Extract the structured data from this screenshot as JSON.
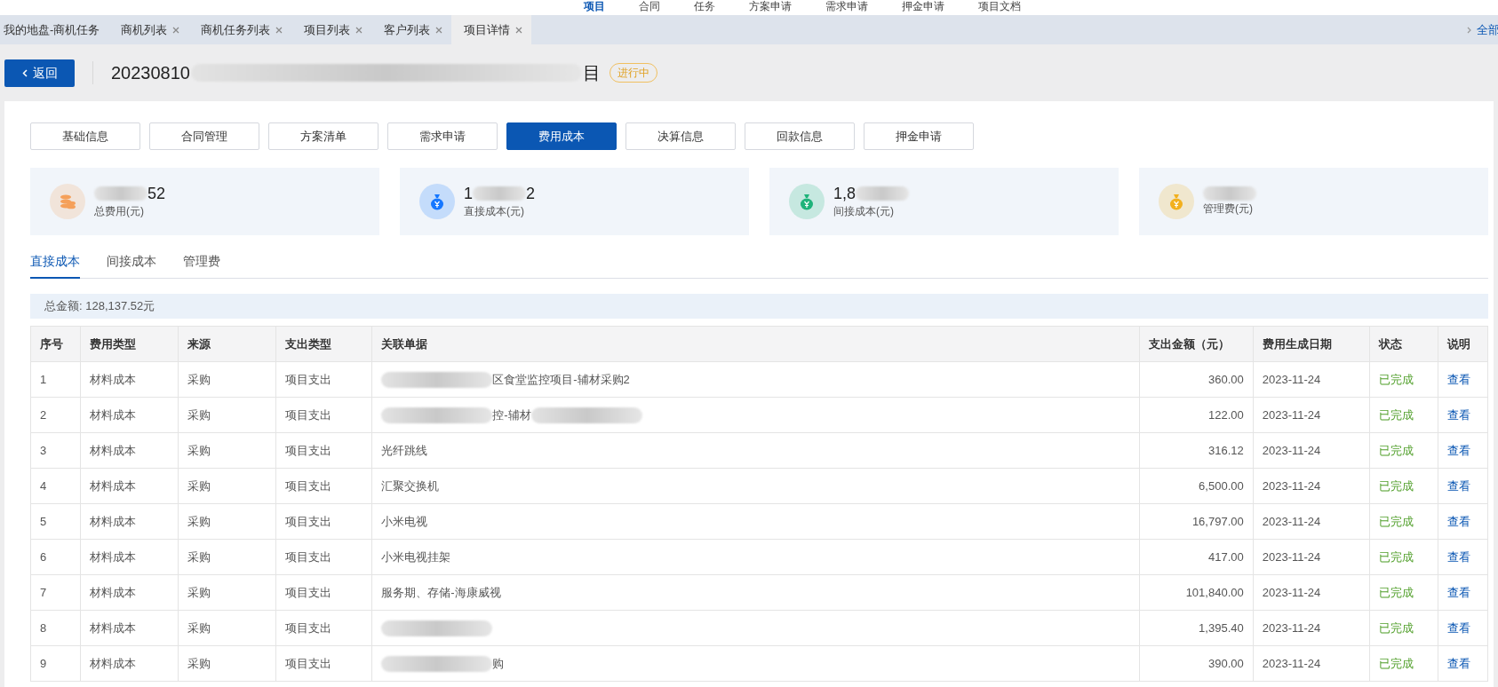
{
  "top_nav": [
    {
      "label": "项目",
      "selected": true
    },
    {
      "label": "合同",
      "selected": false
    },
    {
      "label": "任务",
      "selected": false
    },
    {
      "label": "方案申请",
      "selected": false
    },
    {
      "label": "需求申请",
      "selected": false
    },
    {
      "label": "押金申请",
      "selected": false
    },
    {
      "label": "项目文档",
      "selected": false
    }
  ],
  "page_tabs": [
    {
      "label": "我的地盘-商机任务",
      "closable": false,
      "selected": false
    },
    {
      "label": "商机列表",
      "closable": true,
      "selected": false
    },
    {
      "label": "商机任务列表",
      "closable": true,
      "selected": false
    },
    {
      "label": "项目列表",
      "closable": true,
      "selected": false
    },
    {
      "label": "客户列表",
      "closable": true,
      "selected": false
    },
    {
      "label": "项目详情",
      "closable": true,
      "selected": true
    }
  ],
  "tab_overflow": "全部",
  "header": {
    "back_button": "返回",
    "title": [
      {
        "kind": "text",
        "text": "20230810"
      },
      {
        "kind": "blur"
      },
      {
        "kind": "text",
        "text": "目"
      }
    ],
    "status_badge": "进行中"
  },
  "sections": [
    {
      "label": "基础信息",
      "selected": false
    },
    {
      "label": "合同管理",
      "selected": false
    },
    {
      "label": "方案清单",
      "selected": false
    },
    {
      "label": "需求申请",
      "selected": false
    },
    {
      "label": "费用成本",
      "selected": true
    },
    {
      "label": "决算信息",
      "selected": false
    },
    {
      "label": "回款信息",
      "selected": false
    },
    {
      "label": "押金申请",
      "selected": false
    }
  ],
  "stats": [
    {
      "kind": "coins",
      "color": "#f5a05a",
      "value": [
        {
          "kind": "blur"
        },
        {
          "kind": "text",
          "text": "52"
        }
      ],
      "label": "总费用(元)"
    },
    {
      "kind": "bag",
      "color": "#1677ff",
      "value": [
        {
          "kind": "text",
          "text": "1"
        },
        {
          "kind": "blur"
        },
        {
          "kind": "text",
          "text": "2"
        }
      ],
      "label": "直接成本(元)"
    },
    {
      "kind": "bag",
      "color": "#1fb37a",
      "value": [
        {
          "kind": "text",
          "text": "1,8"
        },
        {
          "kind": "blur"
        }
      ],
      "label": "间接成本(元)"
    },
    {
      "kind": "bag",
      "color": "#f2b01e",
      "value": [
        {
          "kind": "blur"
        }
      ],
      "label": "管理费(元)"
    }
  ],
  "cost_tabs": [
    {
      "label": "直接成本",
      "selected": true
    },
    {
      "label": "间接成本",
      "selected": false
    },
    {
      "label": "管理费",
      "selected": false
    }
  ],
  "total": "总金额: 128,137.52元",
  "table": {
    "columns": [
      "序号",
      "费用类型",
      "来源",
      "支出类型",
      "关联单据",
      "支出金额（元）",
      "费用生成日期",
      "状态",
      "说明"
    ],
    "rows": [
      {
        "no": "1",
        "type": "材料成本",
        "source": "采购",
        "spend_type": "项目支出",
        "document": [
          {
            "kind": "blur"
          },
          {
            "kind": "text",
            "text": "区食堂监控项目-辅材采购2"
          }
        ],
        "amount": "360.00",
        "date": "2023-11-24",
        "status": "已完成",
        "action": "查看"
      },
      {
        "no": "2",
        "type": "材料成本",
        "source": "采购",
        "spend_type": "项目支出",
        "document": [
          {
            "kind": "blur"
          },
          {
            "kind": "text",
            "text": "控-辅材"
          },
          {
            "kind": "blur"
          }
        ],
        "amount": "122.00",
        "date": "2023-11-24",
        "status": "已完成",
        "action": "查看"
      },
      {
        "no": "3",
        "type": "材料成本",
        "source": "采购",
        "spend_type": "项目支出",
        "document": [
          {
            "kind": "text",
            "text": "光纤跳线"
          }
        ],
        "amount": "316.12",
        "date": "2023-11-24",
        "status": "已完成",
        "action": "查看"
      },
      {
        "no": "4",
        "type": "材料成本",
        "source": "采购",
        "spend_type": "项目支出",
        "document": [
          {
            "kind": "text",
            "text": "汇聚交换机"
          }
        ],
        "amount": "6,500.00",
        "date": "2023-11-24",
        "status": "已完成",
        "action": "查看"
      },
      {
        "no": "5",
        "type": "材料成本",
        "source": "采购",
        "spend_type": "项目支出",
        "document": [
          {
            "kind": "text",
            "text": "小米电视"
          }
        ],
        "amount": "16,797.00",
        "date": "2023-11-24",
        "status": "已完成",
        "action": "查看"
      },
      {
        "no": "6",
        "type": "材料成本",
        "source": "采购",
        "spend_type": "项目支出",
        "document": [
          {
            "kind": "text",
            "text": "小米电视挂架"
          }
        ],
        "amount": "417.00",
        "date": "2023-11-24",
        "status": "已完成",
        "action": "查看"
      },
      {
        "no": "7",
        "type": "材料成本",
        "source": "采购",
        "spend_type": "项目支出",
        "document": [
          {
            "kind": "text",
            "text": "服务期、存储-海康威视"
          }
        ],
        "amount": "101,840.00",
        "date": "2023-11-24",
        "status": "已完成",
        "action": "查看"
      },
      {
        "no": "8",
        "type": "材料成本",
        "source": "采购",
        "spend_type": "项目支出",
        "document": [
          {
            "kind": "blur"
          }
        ],
        "amount": "1,395.40",
        "date": "2023-11-24",
        "status": "已完成",
        "action": "查看"
      },
      {
        "no": "9",
        "type": "材料成本",
        "source": "采购",
        "spend_type": "项目支出",
        "document": [
          {
            "kind": "blur"
          },
          {
            "kind": "text",
            "text": "购"
          }
        ],
        "amount": "390.00",
        "date": "2023-11-24",
        "status": "已完成",
        "action": "查看"
      }
    ]
  }
}
